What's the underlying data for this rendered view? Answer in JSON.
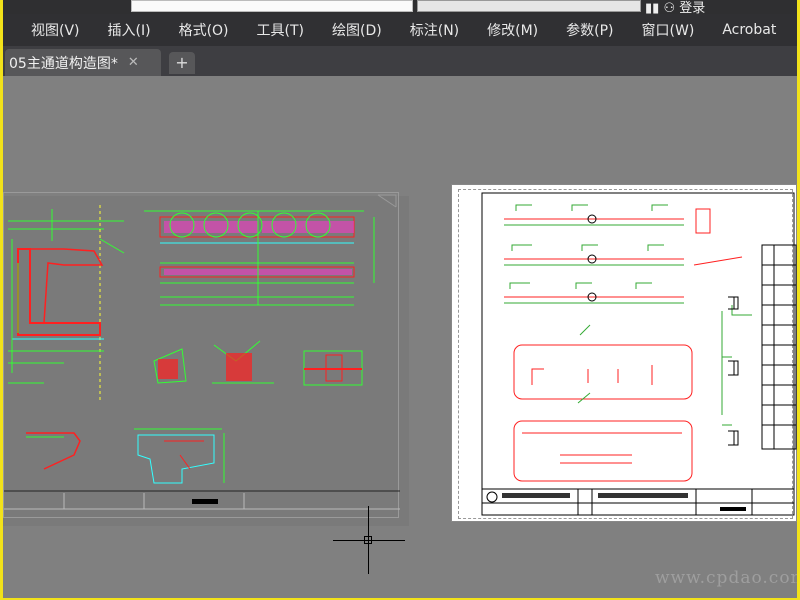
{
  "menubar": {
    "items": [
      "视图(V)",
      "插入(I)",
      "格式(O)",
      "工具(T)",
      "绘图(D)",
      "标注(N)",
      "修改(M)",
      "参数(P)",
      "窗口(W)",
      "Acrobat"
    ]
  },
  "tabs": {
    "active_label": "05主通道构造图*",
    "close_symbol": "✕",
    "new_symbol": "+"
  },
  "header": {
    "login_label": "登录"
  },
  "watermark": {
    "text": "www.cpdao.com"
  },
  "colors": {
    "accent_frame": "#f2e21a",
    "line_green": "#33ff33",
    "line_red": "#ff2020",
    "line_magenta": "#ff33cc",
    "line_cyan": "#33ffff"
  }
}
